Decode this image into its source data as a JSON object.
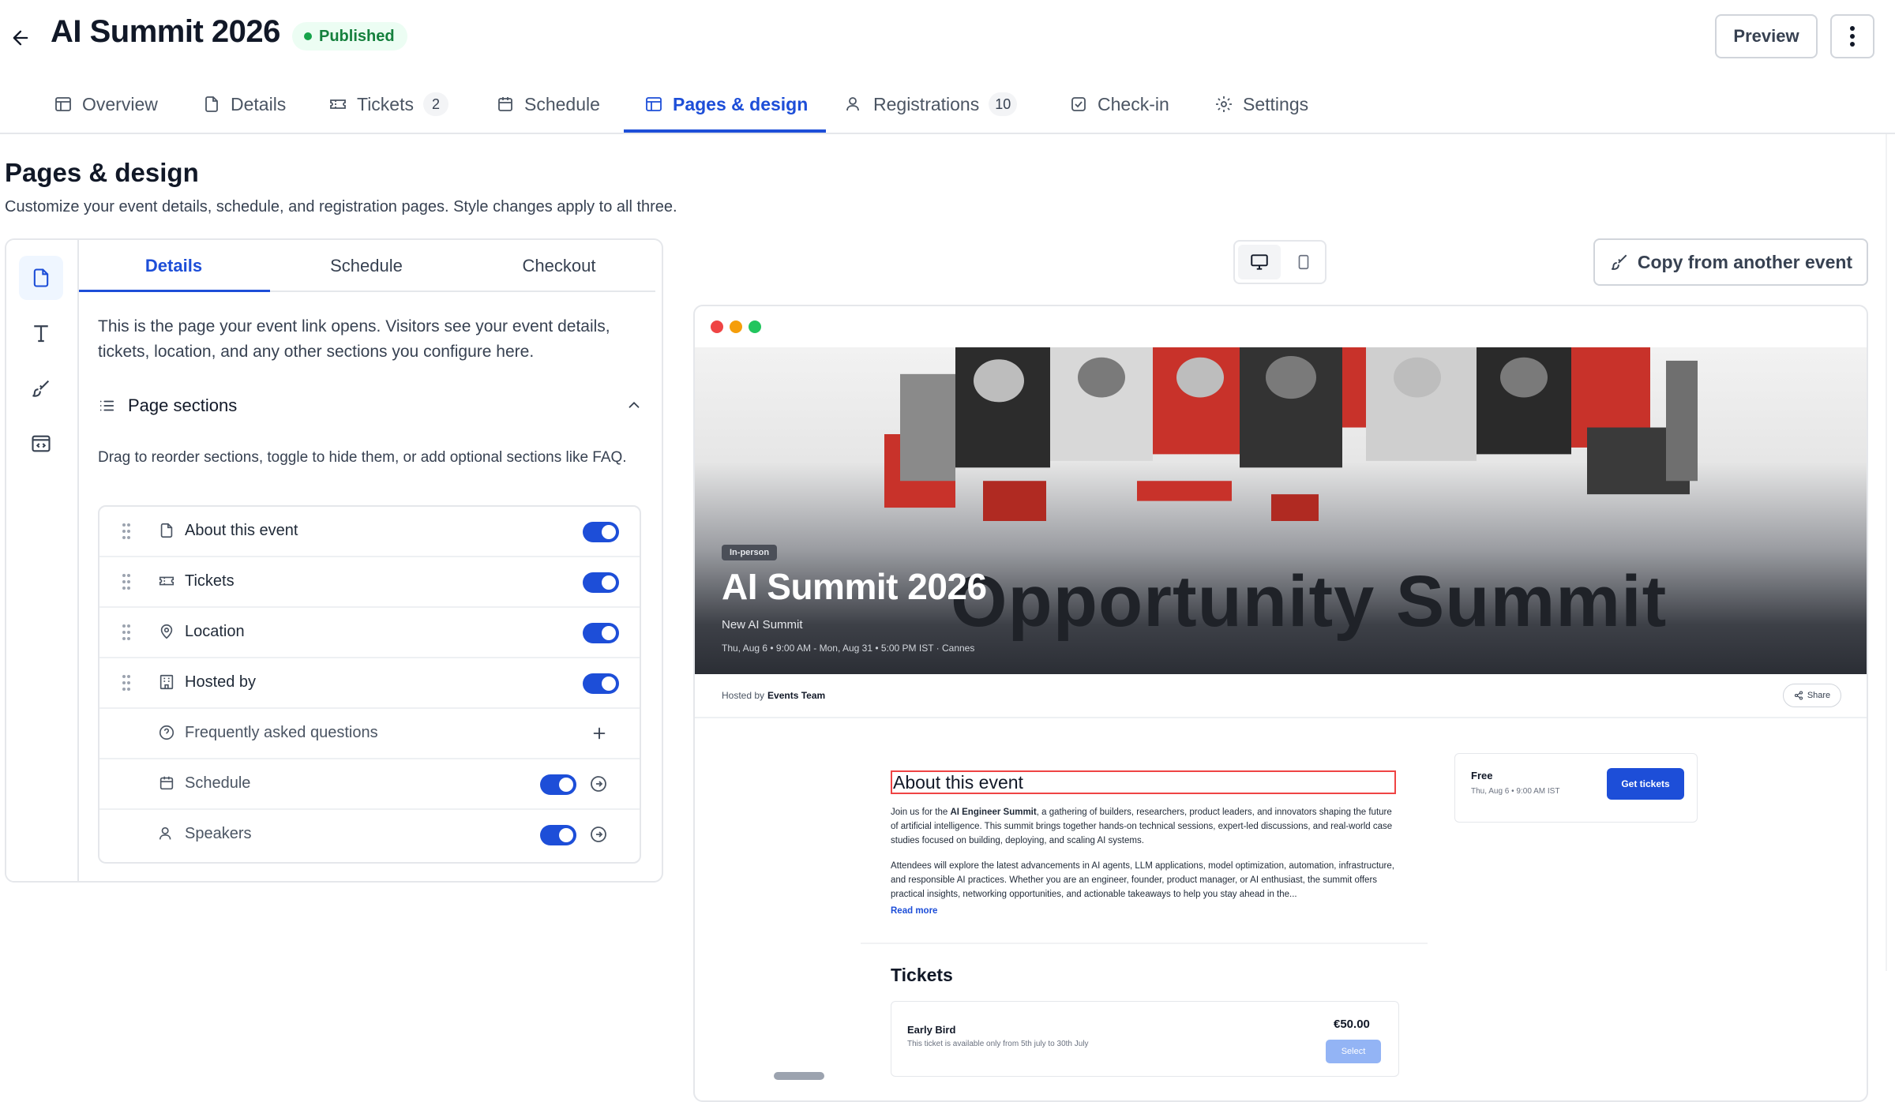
{
  "header": {
    "title": "AI Summit 2026",
    "status": "Published",
    "preview_label": "Preview"
  },
  "tabs": [
    {
      "label": "Overview",
      "icon": "layout-icon"
    },
    {
      "label": "Details",
      "icon": "file-icon"
    },
    {
      "label": "Tickets",
      "icon": "ticket-icon",
      "count": "2"
    },
    {
      "label": "Schedule",
      "icon": "calendar-icon"
    },
    {
      "label": "Pages & design",
      "icon": "layout-icon",
      "active": true
    },
    {
      "label": "Registrations",
      "icon": "user-icon",
      "count": "10"
    },
    {
      "label": "Check-in",
      "icon": "check-square-icon"
    },
    {
      "label": "Settings",
      "icon": "gear-icon"
    }
  ],
  "main": {
    "title": "Pages & design",
    "description": "Customize your event details, schedule, and registration pages. Style changes apply to all three."
  },
  "editor": {
    "subtabs": [
      "Details",
      "Schedule",
      "Checkout"
    ],
    "info": "This is the page your event link opens. Visitors see your event details, tickets, location, and any other sections you configure here.",
    "sections_heading": "Page sections",
    "sections_help": "Drag to reorder sections, toggle to hide them, or add optional sections like FAQ.",
    "sections": [
      {
        "label": "About this event",
        "icon": "file-icon",
        "enabled": true
      },
      {
        "label": "Tickets",
        "icon": "ticket-icon",
        "enabled": true
      },
      {
        "label": "Location",
        "icon": "map-pin-icon",
        "enabled": true
      },
      {
        "label": "Hosted by",
        "icon": "building-icon",
        "enabled": true
      },
      {
        "label": "Frequently asked questions",
        "icon": "help-circle-icon",
        "optional": true
      },
      {
        "label": "Schedule",
        "icon": "calendar-icon",
        "enabled": true,
        "linked": true
      },
      {
        "label": "Speakers",
        "icon": "user-icon",
        "enabled": true,
        "linked": true
      }
    ]
  },
  "preview_controls": {
    "copy_label": "Copy from another event"
  },
  "event_preview": {
    "badge": "In-person",
    "title": "AI Summit 2026",
    "subtitle": "New AI Summit",
    "date": "Thu, Aug 6 • 9:00 AM - Mon, Aug 31 • 5:00 PM IST · Cannes",
    "watermark": "Opportunity Summit",
    "hosted_by_label": "Hosted by",
    "host": "Events Team",
    "share_label": "Share",
    "about_title": "About this event",
    "about_p1_lead": "Join us for the ",
    "about_p1_bold": "AI Engineer Summit",
    "about_p1_rest": ", a gathering of builders, researchers, product leaders, and innovators shaping the future of artificial intelligence. This summit brings together hands-on technical sessions, expert-led discussions, and real-world case studies focused on building, deploying, and scaling AI systems.",
    "about_p2": "Attendees will explore the latest advancements in AI agents, LLM applications, model optimization, automation, infrastructure, and responsible AI practices. Whether you are an engineer, founder, product manager, or AI enthusiast, the summit offers practical insights, networking opportunities, and actionable takeaways to help you stay ahead in the...",
    "read_more": "Read more",
    "ticket_card": {
      "price": "Free",
      "date": "Thu, Aug 6 • 9:00 AM IST",
      "button": "Get tickets"
    },
    "tickets_title": "Tickets",
    "ticket": {
      "name": "Early Bird",
      "note": "This ticket is available only from 5th july to 30th July",
      "price": "€50.00",
      "button": "Select"
    }
  },
  "colors": {
    "accent": "#1d4ed8",
    "published": "#16a34a",
    "highlight_border": "#ef4444"
  }
}
